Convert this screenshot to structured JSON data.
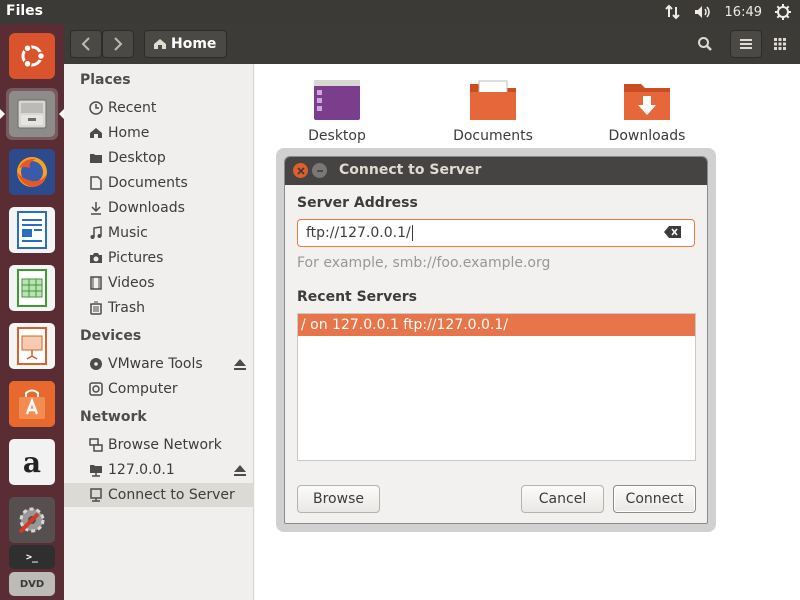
{
  "top_panel": {
    "app_title": "Files",
    "time": "16:49",
    "icons": [
      "network-transfer-icon",
      "volume-icon",
      "power-gear-icon"
    ]
  },
  "launcher": {
    "items": [
      {
        "name": "ubuntu-dash",
        "icon": "ubuntu-logo-icon"
      },
      {
        "name": "files",
        "icon": "file-cabinet-icon",
        "active": true
      },
      {
        "name": "firefox",
        "icon": "firefox-icon"
      },
      {
        "name": "libreoffice-writer",
        "icon": "writer-icon"
      },
      {
        "name": "libreoffice-calc",
        "icon": "calc-icon"
      },
      {
        "name": "libreoffice-impress",
        "icon": "impress-icon"
      },
      {
        "name": "software-center",
        "icon": "software-bag-icon"
      },
      {
        "name": "amazon",
        "icon": "amazon-icon",
        "label": "a"
      },
      {
        "name": "system-settings",
        "icon": "settings-wrench-icon"
      },
      {
        "name": "terminal",
        "icon": "terminal-icon",
        "label": ">_"
      },
      {
        "name": "dvd",
        "icon": "dvd-icon",
        "label": "DVD"
      }
    ]
  },
  "headerbar": {
    "location": "Home"
  },
  "sidebar": {
    "places_header": "Places",
    "places": [
      {
        "label": "Recent",
        "icon": "clock-icon"
      },
      {
        "label": "Home",
        "icon": "home-icon"
      },
      {
        "label": "Desktop",
        "icon": "folder-icon"
      },
      {
        "label": "Documents",
        "icon": "document-icon"
      },
      {
        "label": "Downloads",
        "icon": "download-icon"
      },
      {
        "label": "Music",
        "icon": "music-icon"
      },
      {
        "label": "Pictures",
        "icon": "camera-icon"
      },
      {
        "label": "Videos",
        "icon": "film-icon"
      },
      {
        "label": "Trash",
        "icon": "trash-icon"
      }
    ],
    "devices_header": "Devices",
    "devices": [
      {
        "label": "VMware Tools",
        "icon": "disc-icon",
        "eject": true
      },
      {
        "label": "Computer",
        "icon": "drive-icon"
      }
    ],
    "network_header": "Network",
    "network": [
      {
        "label": "Browse Network",
        "icon": "network-icon"
      },
      {
        "label": "127.0.0.1",
        "icon": "folder-remote-icon",
        "eject": true
      },
      {
        "label": "Connect to Server",
        "icon": "server-icon",
        "active": true
      }
    ]
  },
  "content": {
    "folders": [
      {
        "label": "Desktop",
        "color": "#7a3e8c"
      },
      {
        "label": "Documents",
        "color": "#e5673a"
      },
      {
        "label": "Downloads",
        "color": "#e5673a"
      }
    ]
  },
  "dialog": {
    "title": "Connect to Server",
    "server_address_label": "Server Address",
    "server_address_value": "ftp://127.0.0.1/",
    "hint": "For example, smb://foo.example.org",
    "recent_label": "Recent Servers",
    "recent_servers": [
      "/ on 127.0.0.1  ftp://127.0.0.1/"
    ],
    "browse_label": "Browse",
    "cancel_label": "Cancel",
    "connect_label": "Connect"
  },
  "colors": {
    "accent": "#e8754a",
    "launcher_bg": "#5a2d35",
    "panel_bg": "#3b3a37"
  }
}
